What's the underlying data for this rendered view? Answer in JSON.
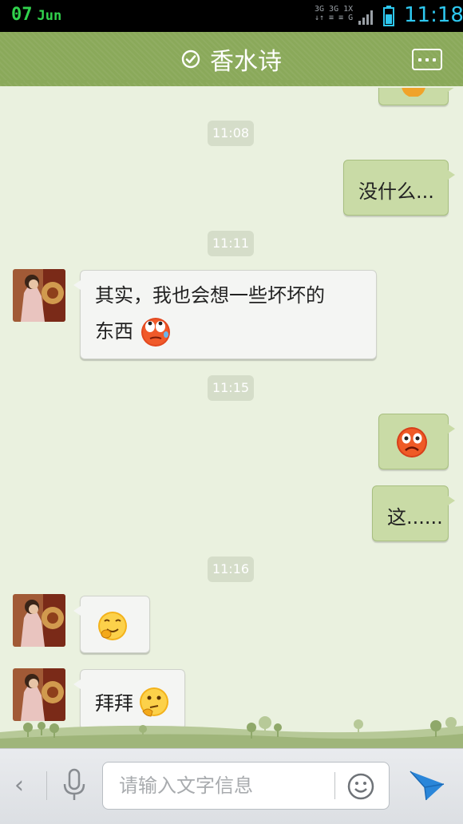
{
  "status_bar": {
    "day": "07",
    "month": "Jun",
    "network_top": "3G 3G 1X",
    "network_bottom": "↓↑ ≡ ≡  G",
    "time": "11:18"
  },
  "header": {
    "title": "香水诗"
  },
  "messages": {
    "ts1": "11:08",
    "m1": "没什么...",
    "ts2": "11:11",
    "m2_line1": "其实，我也会想一些坏坏的",
    "m2_line2": "东西",
    "ts3": "11:15",
    "m4": "这......",
    "ts4": "11:16",
    "m6": "拜拜"
  },
  "input_bar": {
    "placeholder": "请输入文字信息",
    "back_glyph": "‹"
  },
  "colors": {
    "header": "#8aa95a",
    "background": "#eaf1df",
    "bubble_right": "#c9dba6",
    "bubble_left": "#f4f5f3",
    "send": "#2a86d9"
  }
}
